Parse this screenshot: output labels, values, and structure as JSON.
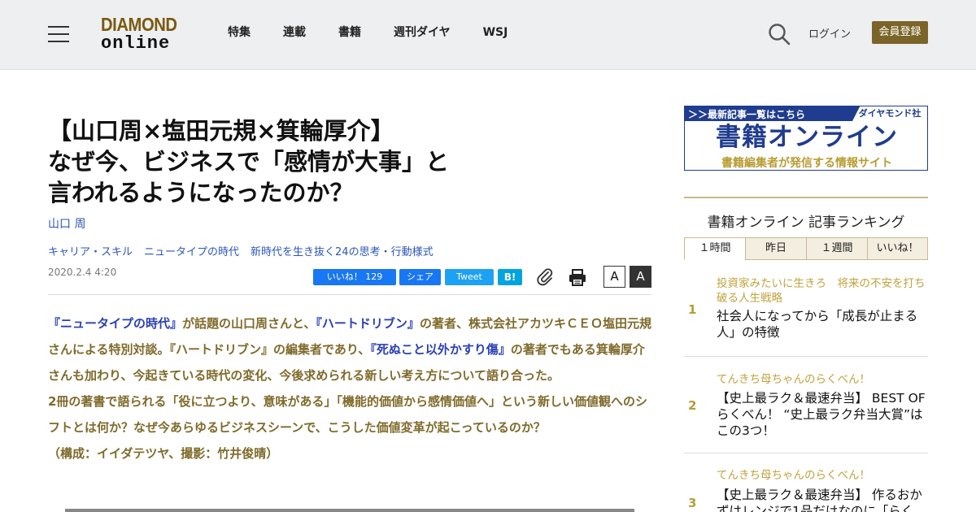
{
  "header": {
    "logo_top": "DIAMOND",
    "logo_bottom": "online",
    "nav": [
      "特集",
      "連載",
      "書籍",
      "週刊ダイヤ",
      "WSJ"
    ],
    "login": "ログイン",
    "register": "会員登録"
  },
  "article": {
    "title_lines": [
      "【山口周×塩田元規×箕輪厚介】",
      "なぜ今、ビジネスで「感情が大事」と",
      "言われるようになったのか？"
    ],
    "author": "山口 周",
    "tags": [
      "キャリア・スキル",
      "ニュータイプの時代",
      "新時代を生き抜く24の思考・行動様式"
    ],
    "date": "2020.2.4 4:20",
    "share": {
      "like": "いいね！ 129",
      "fb_share": "シェア",
      "tweet": "Tweet",
      "hatena": "B!"
    },
    "font_small": "A",
    "font_large": "A",
    "lead": {
      "book1": "『ニュータイプの時代』",
      "t1": "が話題の山口周さんと、",
      "book2": "『ハートドリブン』",
      "t2": "の著者、株式会社アカツキＣＥＯ塩田元規さんによる特別対談。『ハートドリブン』の編集者であり、",
      "book3": "『死ぬこと以外かすり傷』",
      "t3": "の著者でもある箕輪厚介さんも加わり、今起きている時代の変化、今後求められる新しい考え方について語り合った。",
      "p2": "2冊の著書で語られる「役に立つより、意味がある」「機能的価値から感情価値へ」という新しい価値観へのシフトとは何か？なぜ今あらゆるビジネスシーンで、こうした価値変革が起こっているのか？",
      "credit": "（構成：イイダテツヤ、撮影：竹井俊晴）"
    }
  },
  "sidebar": {
    "banner": {
      "link": "＞＞最新記事一覧はこちら",
      "brand": "ダイヤモンド社",
      "title": "書籍オンライン",
      "subtitle": "書籍編集者が発信する情報サイト"
    },
    "ranking_title": "書籍オンライン 記事ランキング",
    "tabs": [
      "１時間",
      "昨日",
      "１週間",
      "いいね！"
    ],
    "items": [
      {
        "num": "1",
        "category": "投資家みたいに生きろ　将来の不安を打ち破る人生戦略",
        "title": "社会人になってから「成長が止まる人」の特徴"
      },
      {
        "num": "2",
        "category": "てんきち母ちゃんのらくべん！",
        "title": "【史上最ラク＆最速弁当】 BEST OF らくべん！ “史上最ラク弁当大賞”は この3つ！"
      },
      {
        "num": "3",
        "category": "てんきち母ちゃんのらくべん！",
        "title": "【史上最ラク＆最速弁当】 作るおかずはレンジで1品だけなのに「らく"
      }
    ]
  }
}
